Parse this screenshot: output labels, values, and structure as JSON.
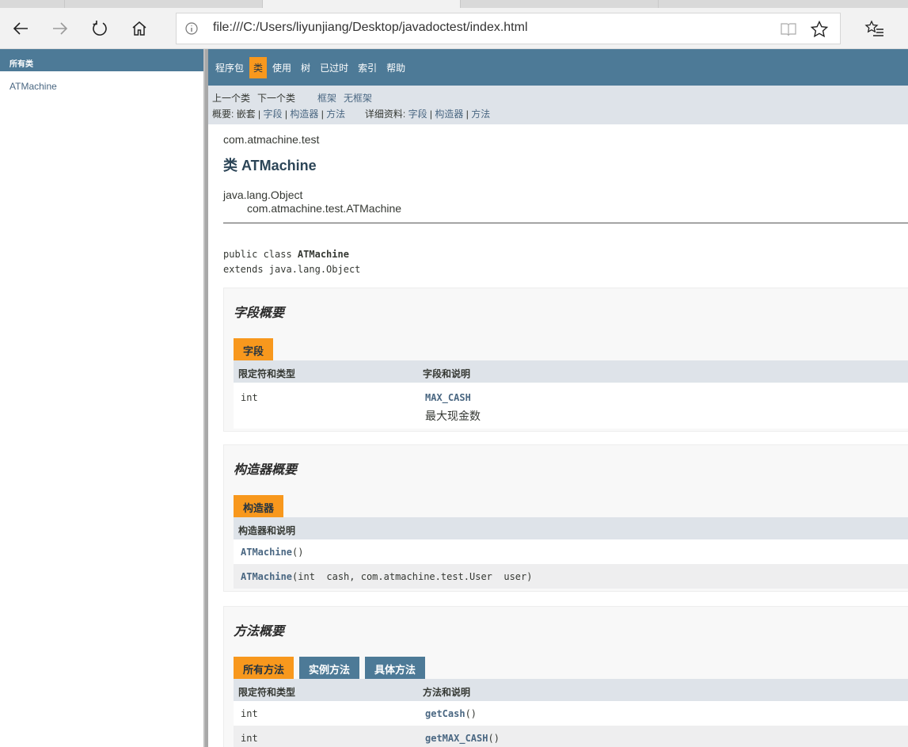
{
  "browser": {
    "url": "file:///C:/Users/liyunjiang/Desktop/javadoctest/index.html"
  },
  "left_frame": {
    "header": "所有类",
    "classes": [
      "ATMachine"
    ]
  },
  "top_nav": {
    "items": [
      "程序包",
      "类",
      "使用",
      "树",
      "已过时",
      "索引",
      "帮助"
    ],
    "active": "类"
  },
  "sub_nav": {
    "prev_class": "上一个类",
    "next_class": "下一个类",
    "frames": "框架",
    "no_frames": "无框架",
    "summary_label": "概要:",
    "summary_nested": "嵌套",
    "summary_field": "字段",
    "summary_constructor": "构造器",
    "summary_method": "方法",
    "detail_label": "详细资料:",
    "detail_field": "字段",
    "detail_constructor": "构造器",
    "detail_method": "方法",
    "sep": "|"
  },
  "class_info": {
    "package": "com.atmachine.test",
    "title": "类 ATMachine",
    "inherit_root": "java.lang.Object",
    "inherit_child": "com.atmachine.test.ATMachine",
    "sig_prefix": "public class ",
    "sig_name": "ATMachine",
    "sig_extends": "extends java.lang.Object"
  },
  "field_summary": {
    "heading": "字段概要",
    "caption": "字段",
    "col1": "限定符和类型",
    "col2": "字段和说明",
    "rows": [
      {
        "type": "int",
        "name": "MAX_CASH",
        "desc": "最大现金数"
      }
    ]
  },
  "constructor_summary": {
    "heading": "构造器概要",
    "caption": "构造器",
    "col1": "构造器和说明",
    "rows": [
      {
        "name": "ATMachine",
        "params": "()"
      },
      {
        "name": "ATMachine",
        "params": "(int  cash, com.atmachine.test.User  user)"
      }
    ]
  },
  "method_summary": {
    "heading": "方法概要",
    "tabs": [
      "所有方法",
      "实例方法",
      "具体方法"
    ],
    "col1": "限定符和类型",
    "col2": "方法和说明",
    "rows": [
      {
        "type": "int",
        "name": "getCash",
        "params": "()"
      },
      {
        "type": "int",
        "name": "getMAX_CASH",
        "params": "()"
      }
    ]
  },
  "colors": {
    "nav_bar": "#4d7a97",
    "active_tab": "#f8981d",
    "sub_nav": "#dee3e9",
    "link": "#4a6782"
  }
}
